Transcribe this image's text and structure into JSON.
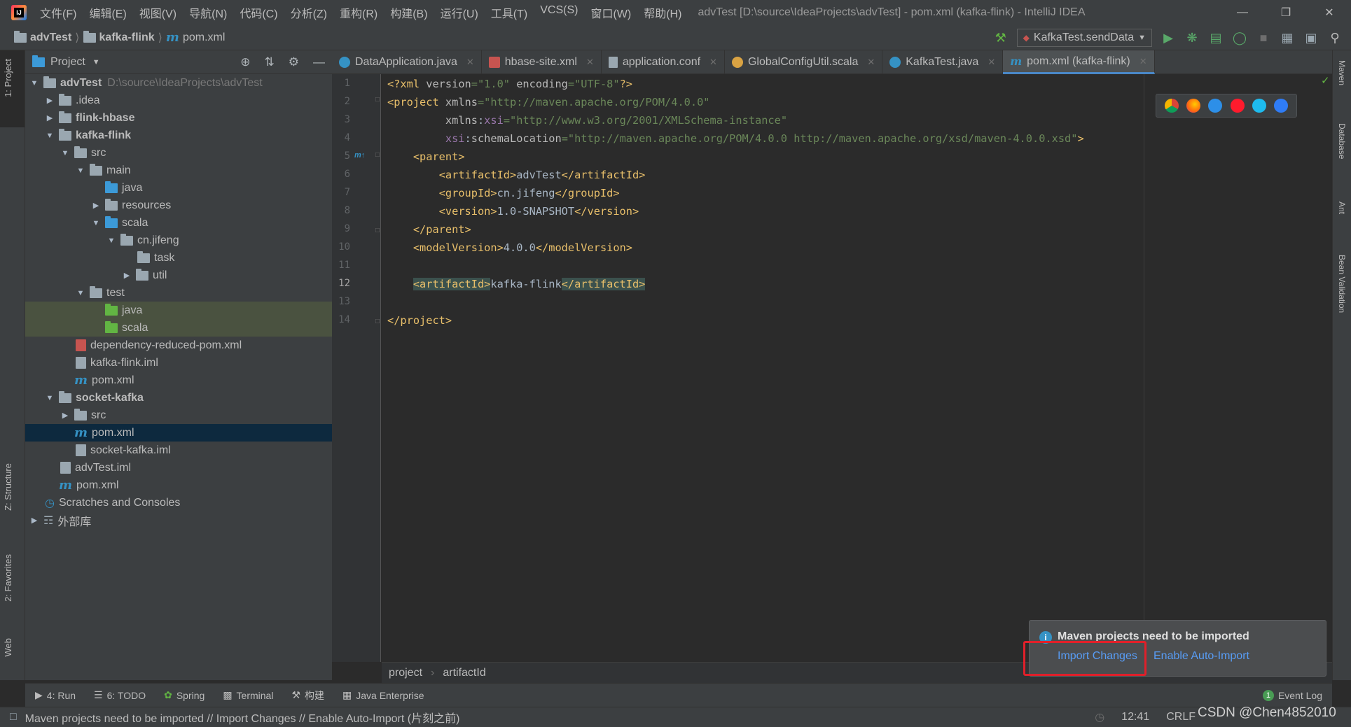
{
  "window": {
    "title": "advTest [D:\\source\\IdeaProjects\\advTest] - pom.xml (kafka-flink) - IntelliJ IDEA",
    "menu": [
      "文件(F)",
      "编辑(E)",
      "视图(V)",
      "导航(N)",
      "代码(C)",
      "分析(Z)",
      "重构(R)",
      "构建(B)",
      "运行(U)",
      "工具(T)",
      "VCS(S)",
      "窗口(W)",
      "帮助(H)"
    ]
  },
  "navbar": {
    "crumbs": [
      "advTest",
      "kafka-flink",
      "pom.xml"
    ],
    "run_config": "KafkaTest.sendData"
  },
  "left_strip": {
    "project": "1: Project",
    "structure": "Z: Structure",
    "favorites": "2: Favorites",
    "web": "Web"
  },
  "right_strip": {
    "maven": "Maven",
    "database": "Database",
    "ant": "Ant",
    "bean": "Bean Validation"
  },
  "project_panel": {
    "title": "Project",
    "tree": [
      {
        "label": "advTest",
        "path": "D:\\source\\IdeaProjects\\advTest",
        "bold": true
      },
      {
        "label": ".idea"
      },
      {
        "label": "flink-hbase",
        "bold": true
      },
      {
        "label": "kafka-flink",
        "bold": true
      },
      {
        "label": "src"
      },
      {
        "label": "main"
      },
      {
        "label": "java"
      },
      {
        "label": "resources"
      },
      {
        "label": "scala"
      },
      {
        "label": "cn.jifeng"
      },
      {
        "label": "task"
      },
      {
        "label": "util"
      },
      {
        "label": "test"
      },
      {
        "label": "java"
      },
      {
        "label": "scala"
      },
      {
        "label": "dependency-reduced-pom.xml"
      },
      {
        "label": "kafka-flink.iml"
      },
      {
        "label": "pom.xml"
      },
      {
        "label": "socket-kafka",
        "bold": true
      },
      {
        "label": "src"
      },
      {
        "label": "pom.xml"
      },
      {
        "label": "socket-kafka.iml"
      },
      {
        "label": "advTest.iml"
      },
      {
        "label": "pom.xml"
      },
      {
        "label": "Scratches and Consoles"
      },
      {
        "label": "外部库"
      }
    ]
  },
  "tabs": [
    {
      "label": "DataApplication.java",
      "color": "#3592c4"
    },
    {
      "label": "hbase-site.xml",
      "color": "#c75450"
    },
    {
      "label": "application.conf",
      "color": "#9aa7b0"
    },
    {
      "label": "GlobalConfigUtil.scala",
      "color": "#d9a343"
    },
    {
      "label": "KafkaTest.java",
      "color": "#3592c4"
    },
    {
      "label": "pom.xml (kafka-flink)",
      "color": "#3592c4",
      "active": true
    }
  ],
  "editor": {
    "line_numbers": [
      "1",
      "2",
      "3",
      "4",
      "5",
      "6",
      "7",
      "8",
      "9",
      "10",
      "11",
      "12",
      "13",
      "14"
    ],
    "breadcrumb": [
      "project",
      "artifactId"
    ]
  },
  "bottom_tools": [
    "4: Run",
    "6: TODO",
    "Spring",
    "Terminal",
    "构建",
    "Java Enterprise",
    "Event Log"
  ],
  "event_log_count": "1",
  "status": {
    "message": "Maven projects need to be imported // Import Changes // Enable Auto-Import (片刻之前)",
    "time": "12:41",
    "line_sep": "CRLF"
  },
  "notification": {
    "title": "Maven projects need to be imported",
    "import": "Import Changes",
    "auto": "Enable Auto-Import"
  },
  "watermark": "CSDN @Chen4852010",
  "colors": {
    "accent": "#4a88c7",
    "link": "#589df6",
    "highlight_box": "#e0202a"
  }
}
